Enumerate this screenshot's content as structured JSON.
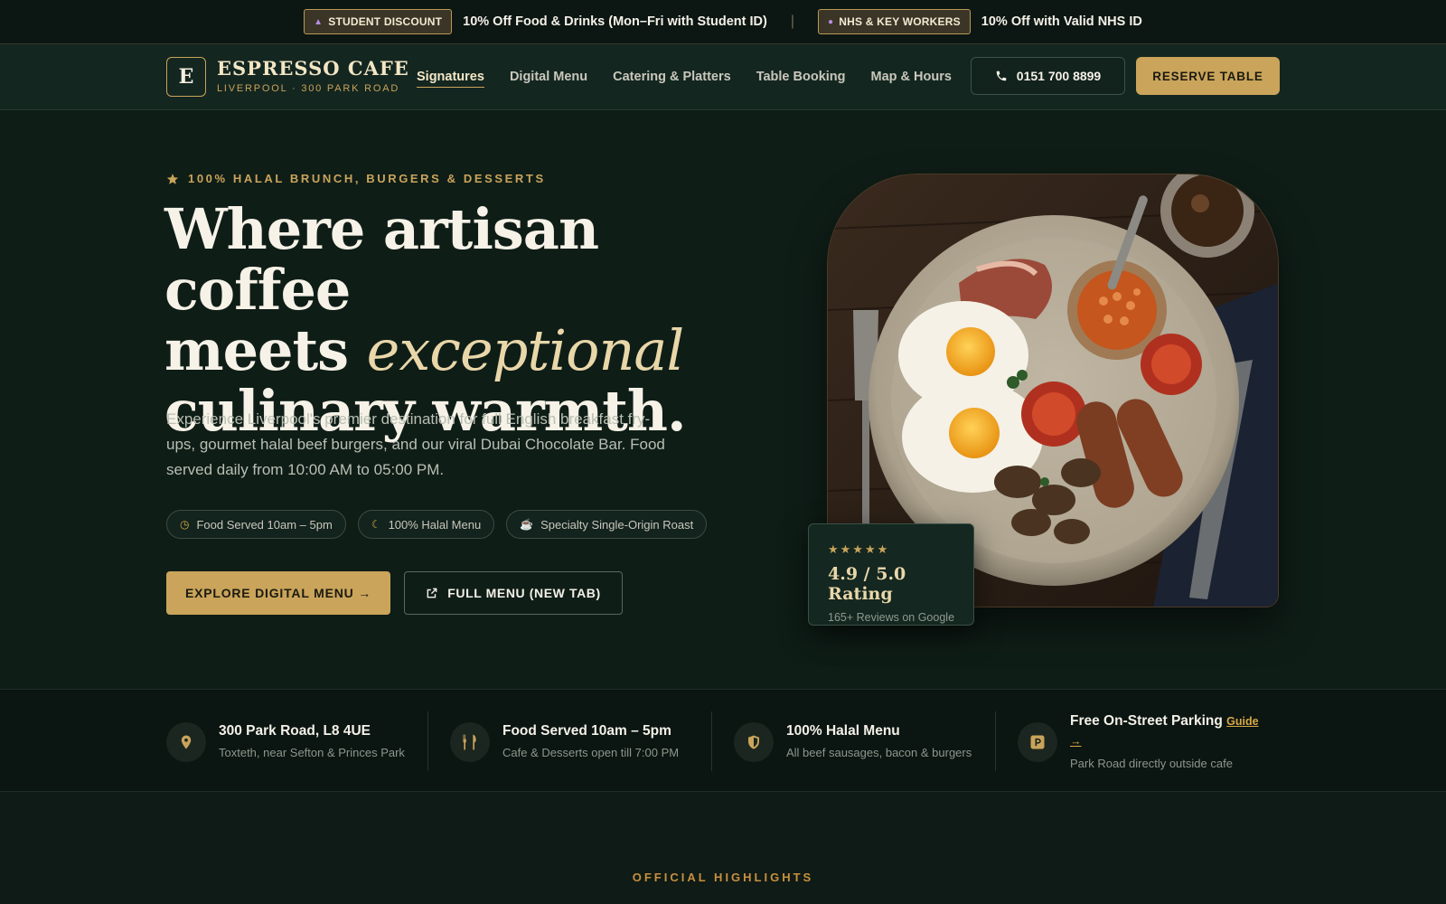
{
  "promo": {
    "student_badge": "STUDENT DISCOUNT",
    "student_text": "10% Off Food & Drinks (Mon–Fri with Student ID)",
    "separator": "|",
    "nhs_badge": "NHS & KEY WORKERS",
    "nhs_text": "10% Off with Valid NHS ID"
  },
  "header": {
    "logo_letter": "E",
    "brand_name": "ESPRESSO CAFE",
    "brand_sub": "LIVERPOOL · 300 PARK ROAD",
    "nav": [
      {
        "label": "Signatures",
        "active": true
      },
      {
        "label": "Digital Menu"
      },
      {
        "label": "Catering & Platters"
      },
      {
        "label": "Table Booking"
      },
      {
        "label": "Map & Hours"
      }
    ],
    "phone": "0151 700 8899",
    "reserve": "RESERVE TABLE"
  },
  "hero": {
    "eyebrow": "100% HALAL BRUNCH, BURGERS & DESSERTS",
    "headline_line1": "Where artisan coffee",
    "headline_line2_a": "meets ",
    "headline_line2_em": "exceptional",
    "headline_line3": "culinary warmth.",
    "lead": "Experience Liverpool's premier destination for full English breakfast fry-ups, gourmet halal beef burgers, and our viral Dubai Chocolate Bar. Food served daily from 10:00 AM to 05:00 PM.",
    "chips": [
      {
        "icon": "clock-icon",
        "label": "Food Served 10am – 5pm"
      },
      {
        "icon": "moon-icon",
        "label": "100% Halal Menu"
      },
      {
        "icon": "coffee-cup-icon",
        "label": "Specialty Single-Origin Roast"
      }
    ],
    "cta_primary": "EXPLORE DIGITAL MENU →",
    "cta_secondary": "FULL MENU (NEW TAB)",
    "rating": {
      "stars": "★★★★★",
      "value": "4.9 / 5.0 Rating",
      "sub": "165+ Reviews on Google"
    }
  },
  "info": [
    {
      "icon": "map-pin-icon",
      "title": "300 Park Road, L8 4UE",
      "sub": "Toxteth, near Sefton & Princes Park"
    },
    {
      "icon": "utensils-icon",
      "title": "Food Served 10am – 5pm",
      "sub": "Cafe & Desserts open till 7:00 PM"
    },
    {
      "icon": "shield-icon",
      "title": "100% Halal Menu",
      "sub": "All beef sausages, bacon & burgers"
    },
    {
      "icon": "parking-icon",
      "title": "Free On-Street Parking",
      "link": "Guide",
      "link_arrow": "→",
      "sub": "Park Road directly outside cafe"
    }
  ],
  "highlights_label": "OFFICIAL HIGHLIGHTS",
  "colors": {
    "accent_gold": "#c9a45a",
    "background": "#0f1b16",
    "header": "#142620"
  }
}
